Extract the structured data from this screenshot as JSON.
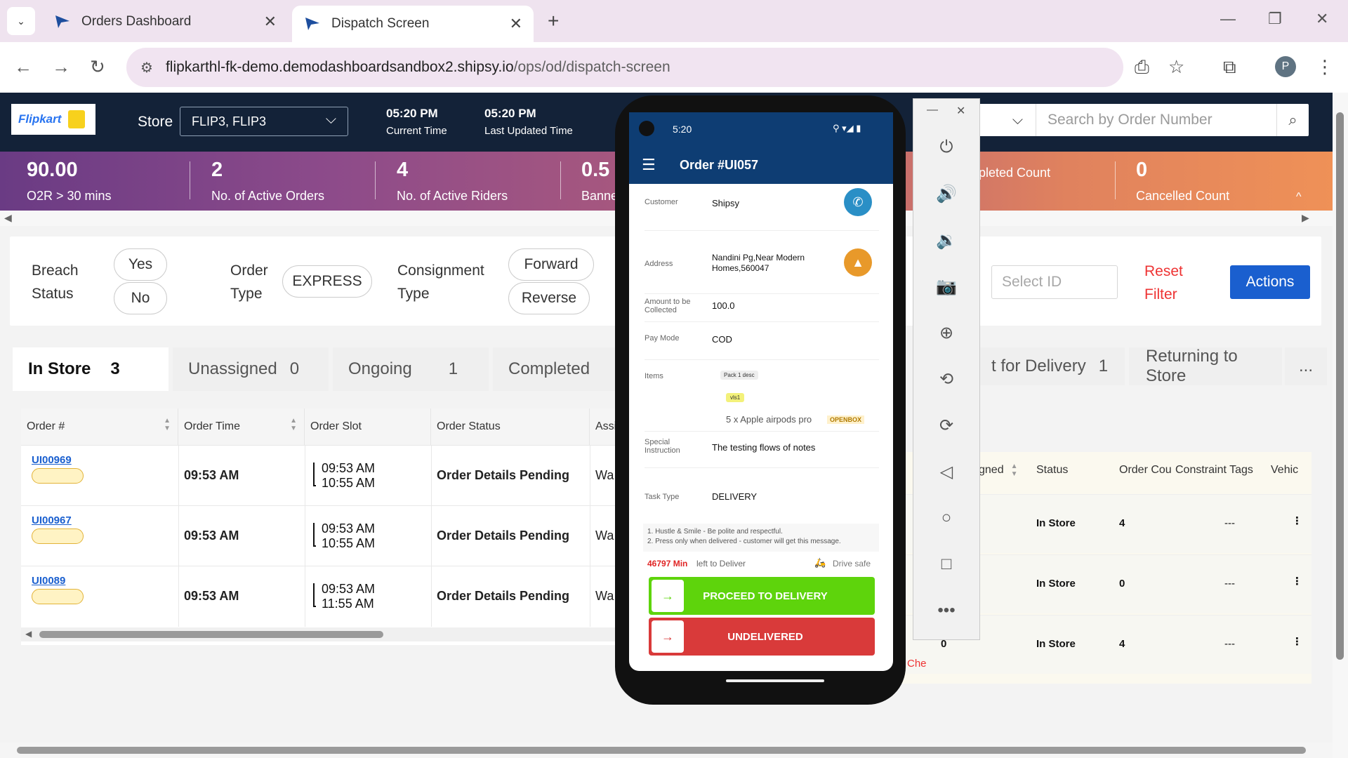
{
  "browser": {
    "tabs": [
      {
        "title": "Orders Dashboard",
        "active": false
      },
      {
        "title": "Dispatch Screen",
        "active": true
      }
    ],
    "url_domain": "flipkarthl-fk-demo.demodashboardsandbox2.shipsy.io",
    "url_path": "/ops/od/dispatch-screen",
    "profile_initial": "P"
  },
  "header": {
    "logo_text": "Flipkart",
    "store_label": "Store",
    "store_value": "FLIP3, FLIP3",
    "current_time": "05:20 PM",
    "current_time_label": "Current Time",
    "last_updated": "05:20 PM",
    "last_updated_label": "Last Updated Time",
    "search_placeholder": "Search by Order Number"
  },
  "stats": [
    {
      "value": "90.00",
      "label": "O2R > 30 mins"
    },
    {
      "value": "2",
      "label": "No. of Active Orders"
    },
    {
      "value": "4",
      "label": "No. of Active Riders"
    },
    {
      "value": "0.5",
      "label": "Banne"
    },
    {
      "value": "",
      "label": "pleted Count"
    },
    {
      "value": "0",
      "label": "Cancelled Count"
    }
  ],
  "filters": {
    "breach_label": "Breach Status",
    "breach_yes": "Yes",
    "breach_no": "No",
    "order_type_label": "Order Type",
    "order_type_express": "EXPRESS",
    "consignment_label": "Consignment Type",
    "forward": "Forward",
    "reverse": "Reverse",
    "select_id_placeholder": "Select ID",
    "reset_filter": "Reset Filter",
    "actions": "Actions"
  },
  "order_tabs": [
    {
      "label": "In Store",
      "count": "3"
    },
    {
      "label": "Unassigned",
      "count": "0"
    },
    {
      "label": "Ongoing",
      "count": "1"
    },
    {
      "label": "Completed",
      "count": ""
    }
  ],
  "rider_tabs": [
    {
      "label": "t for Delivery",
      "count": "1"
    },
    {
      "label": "Returning to Store",
      "count": ""
    }
  ],
  "more_label": "...",
  "order_table": {
    "headers": [
      "Order #",
      "Order Time",
      "Order Slot",
      "Order Status",
      "Assi"
    ],
    "rows": [
      {
        "id": "UI00969",
        "time": "09:53 AM",
        "slot_start": "09:53 AM",
        "slot_end": "10:55 AM",
        "status": "Order Details Pending",
        "assi": "Wa"
      },
      {
        "id": "UI00967",
        "time": "09:53 AM",
        "slot_start": "09:53 AM",
        "slot_end": "10:55 AM",
        "status": "Order Details Pending",
        "assi": "Wa"
      },
      {
        "id": "UI0089",
        "time": "09:53 AM",
        "slot_start": "09:53 AM",
        "slot_end": "11:55 AM",
        "status": "Order Details Pending",
        "assi": "Wa"
      }
    ]
  },
  "rider_table": {
    "headers": [
      "gned",
      "Status",
      "Order Cou",
      "Constraint Tags",
      "Vehic"
    ],
    "rows": [
      {
        "assigned": "",
        "status": "In Store",
        "count": "4",
        "tags": "---",
        "side": ""
      },
      {
        "assigned": "",
        "status": "In Store",
        "count": "0",
        "tags": "---",
        "side": ""
      },
      {
        "assigned": "0",
        "status": "In Store",
        "count": "4",
        "tags": "---",
        "side": "Che"
      }
    ]
  },
  "phone": {
    "status_time": "5:20",
    "title": "Order #UI057",
    "customer_label": "Customer",
    "customer": "Shipsy",
    "address_label": "Address",
    "address": "Nandini Pg,Near Modern Homes,560047",
    "amount_label": "Amount to be Collected",
    "amount": "100.0",
    "paymode_label": "Pay Mode",
    "paymode": "COD",
    "items_label": "Items",
    "pack_tag": "Pack 1 desc",
    "item_chip": "vls1",
    "item": "5 x Apple airpods pro",
    "item_badge": "OPENBOX",
    "instr_label": "Special Instruction",
    "instr": "The testing flows of notes",
    "task_label": "Task Type",
    "task": "DELIVERY",
    "note1": "1. Hustle & Smile - Be polite and respectful.",
    "note2": "2. Press only when delivered - customer will get this message.",
    "minutes": "46797 Min",
    "left_to_deliver": "left to Deliver",
    "drive_safe": "Drive safe",
    "proceed": "PROCEED TO DELIVERY",
    "undelivered": "UNDELIVERED"
  },
  "colors": {
    "header_bg": "#132238",
    "primary": "#1a5fcf",
    "proceed_green": "#5ed40c",
    "undelivered_red": "#d93a3a",
    "phone_appbar": "#0e3d73"
  }
}
